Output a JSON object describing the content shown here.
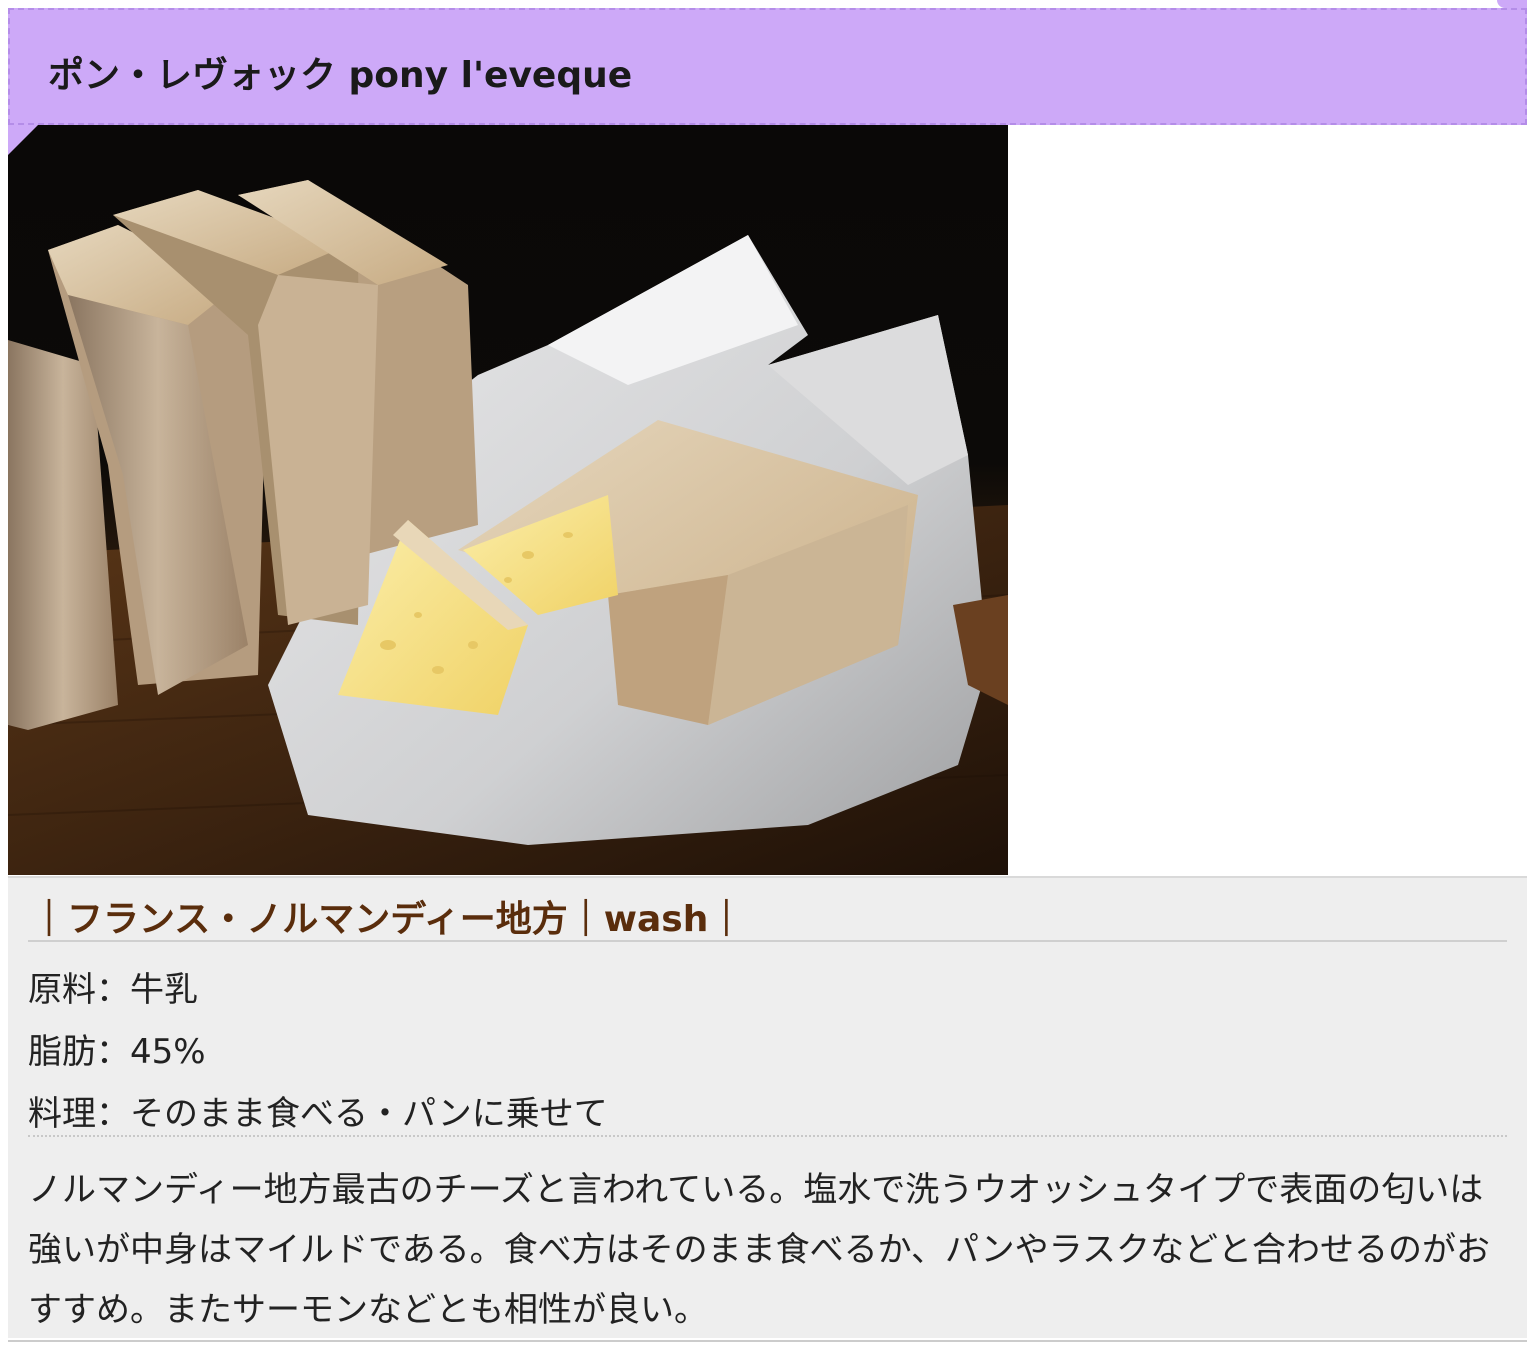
{
  "heading": {
    "title": "ポン・レヴォック pony l'eveque"
  },
  "photo": {
    "alt": "cheese-photo"
  },
  "info": {
    "meta": "｜フランス・ノルマンディー地方｜wash｜",
    "specs": [
      {
        "text": "原料：牛乳"
      },
      {
        "text": "脂肪：45%"
      },
      {
        "text": "料理：そのまま食べる・パンに乗せて"
      }
    ],
    "description": "ノルマンディー地方最古のチーズと言われている。塩水で洗うウオッシュタイプで表面の匂いは強いが中身はマイルドである。食べ方はそのまま食べるか、パンやラスクなどと合わせるのがおすすめ。またサーモンなどとも相性が良い。"
  },
  "colors": {
    "heading_bg": "#cda9f8",
    "info_bg": "#eeeeee",
    "meta_text": "#5a2d0c"
  }
}
